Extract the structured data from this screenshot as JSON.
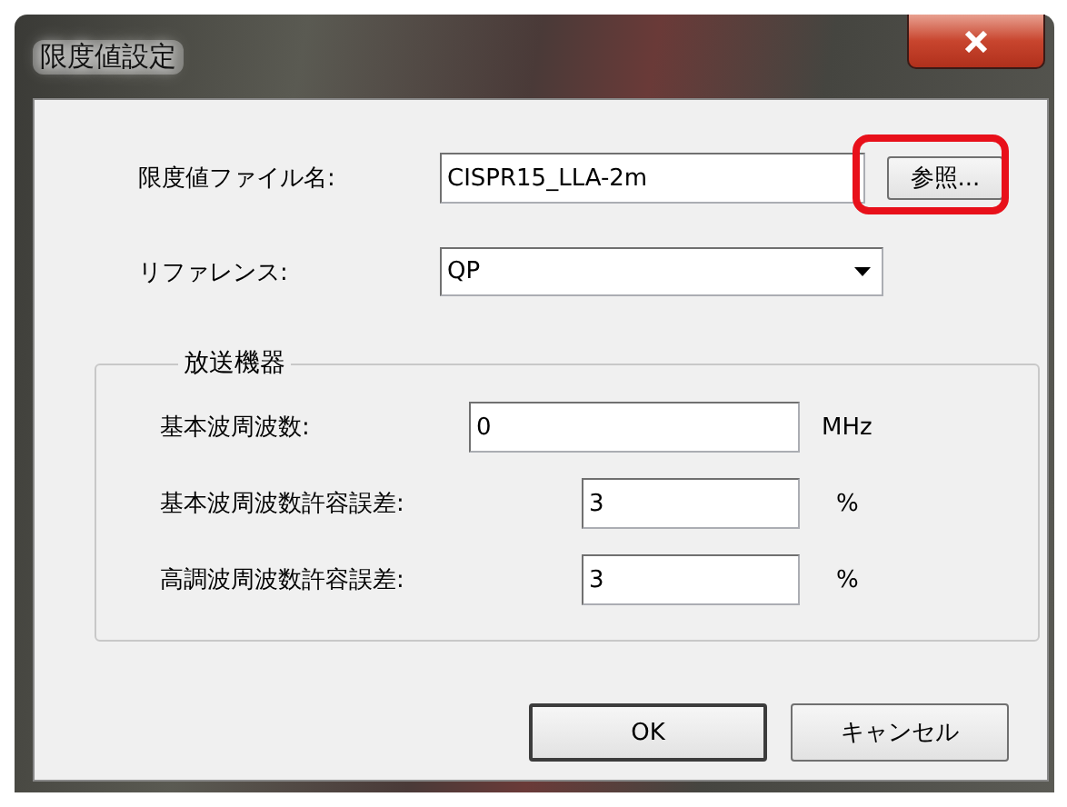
{
  "window": {
    "title": "限度値設定"
  },
  "file_name": {
    "label": "限度値ファイル名:",
    "value": "CISPR15_LLA-2m"
  },
  "browse_button": {
    "label": "参照...",
    "highlighted": true
  },
  "reference": {
    "label": "リファレンス:",
    "value": "QP"
  },
  "group": {
    "title": "放送機器",
    "fields": [
      {
        "label": "基本波周波数:",
        "value": "0",
        "unit": "MHz",
        "kind": "wide"
      },
      {
        "label": "基本波周波数許容誤差:",
        "value": "3",
        "unit": "%",
        "kind": "narrow"
      },
      {
        "label": "高調波周波数許容誤差:",
        "value": "3",
        "unit": "%",
        "kind": "narrow"
      }
    ]
  },
  "buttons": [
    {
      "label": "OK",
      "default": true
    },
    {
      "label": "キャンセル",
      "default": false
    }
  ]
}
